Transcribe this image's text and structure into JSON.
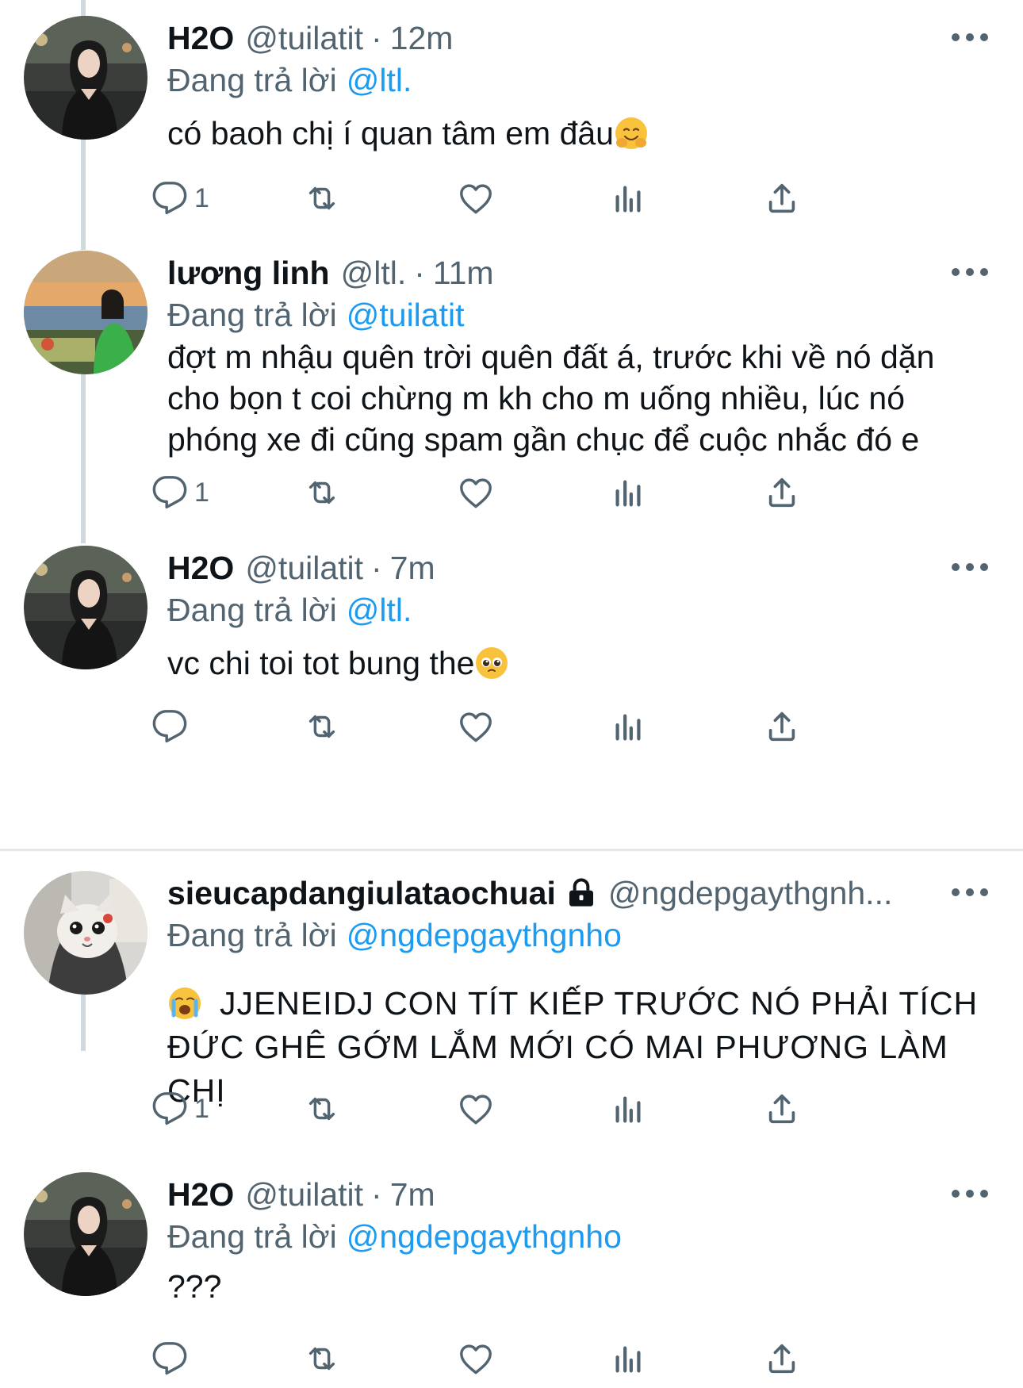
{
  "reply_prefix": "Đang trả lời",
  "tweets": [
    {
      "name": "H2O",
      "handle": "@tuilatit",
      "dot": "·",
      "time": "12m",
      "reply_to": "@ltl.",
      "text": "có baoh chị í quan tâm em đâu",
      "emoji": "hugging-face",
      "reply_count": "1",
      "retweet_count": "",
      "like_count": ""
    },
    {
      "name": "lương linh",
      "handle": "@ltl.",
      "dot": "·",
      "time": "11m",
      "reply_to": "@tuilatit",
      "text_lines": [
        "đợt m nhậu quên trời quên đất á, trước khi về nó dặn",
        "cho bọn t coi chừng m kh cho m uống nhiều, lúc nó",
        "phóng xe đi cũng spam gần chục để cuộc nhắc đó e"
      ],
      "reply_count": "1"
    },
    {
      "name": "H2O",
      "handle": "@tuilatit",
      "dot": "·",
      "time": "7m",
      "reply_to": "@ltl.",
      "text": "vc chi toi tot bung the",
      "emoji": "pleading-face",
      "reply_count": ""
    },
    {
      "name": "sieucapdangiulataochuai",
      "handle": "@ngdepgaythgnh...",
      "reply_to": "@ngdepgaythgnho",
      "emoji": "loudly-crying-face",
      "text_lines": [
        "JJENEIDJ CON TÍT KIẾP TRƯỚC NÓ PHẢI TÍCH",
        "ĐỨC GHÊ GỚM LẮM MỚI CÓ MAI PHƯƠNG LÀM CHỊ"
      ],
      "reply_count": "1"
    },
    {
      "name": "H2O",
      "handle": "@tuilatit",
      "dot": "·",
      "time": "7m",
      "reply_to": "@ngdepgaythgnho",
      "text": "???",
      "reply_count": ""
    }
  ],
  "colors": {
    "accent": "#1d9bf0",
    "secondary_text": "#536471",
    "icon": "#536471",
    "thread_line": "#cfd9de"
  }
}
